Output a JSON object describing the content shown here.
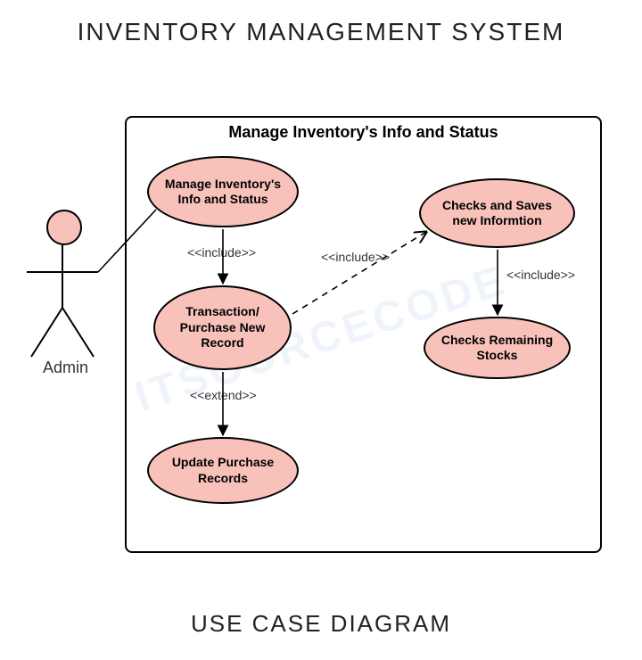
{
  "title": "INVENTORY MANAGEMENT SYSTEM",
  "footer": "USE CASE DIAGRAM",
  "actor": {
    "name": "Admin"
  },
  "system": {
    "title": "Manage Inventory's Info and Status"
  },
  "usecases": {
    "uc1": "Manage Inventory's Info and Status",
    "uc2": "Transaction/ Purchase New Record",
    "uc3": "Update Purchase Records",
    "uc4": "Checks and Saves new Informtion",
    "uc5": "Checks Remaining Stocks"
  },
  "relations": {
    "r1": "<<include>>",
    "r2": "<<include>>",
    "r3": "<<extend>>",
    "r4": "<<include>>"
  }
}
